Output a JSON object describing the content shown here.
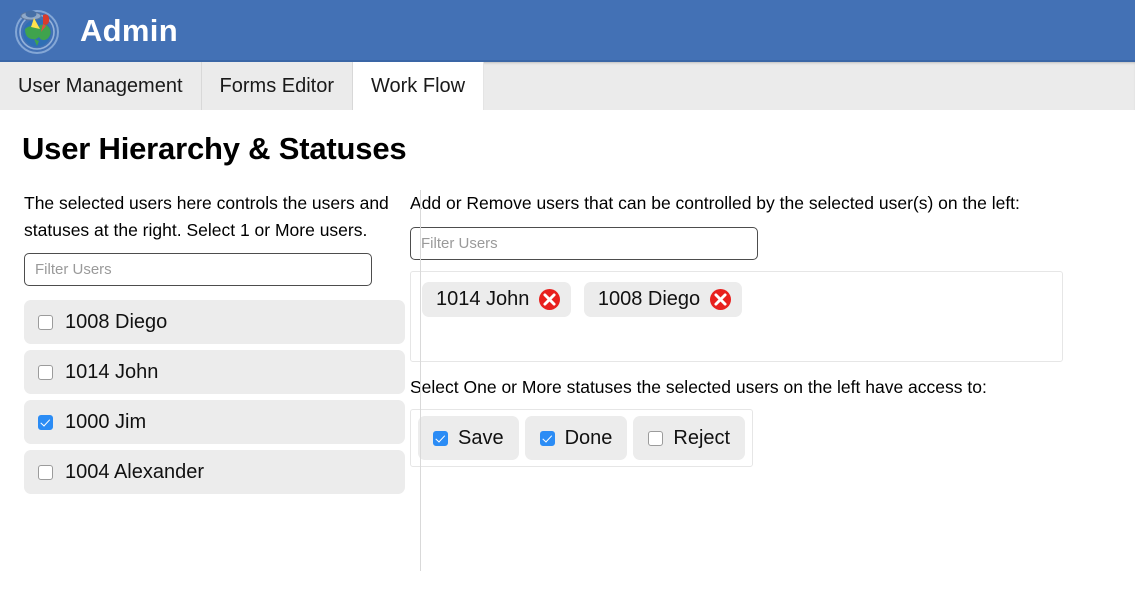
{
  "header": {
    "title": "Admin",
    "logo_icon": "globe-satellite-pin-icon",
    "background_color": "#4371b5"
  },
  "tabs": [
    {
      "label": "User Management",
      "active": false
    },
    {
      "label": "Forms Editor",
      "active": false
    },
    {
      "label": "Work Flow",
      "active": true
    }
  ],
  "page": {
    "title": "User Hierarchy & Statuses"
  },
  "left_panel": {
    "helper_text": "The selected users here controls the users and statuses at the right. Select 1 or More users.",
    "filter": {
      "placeholder": "Filter Users",
      "value": ""
    },
    "users": [
      {
        "label": "1008 Diego",
        "checked": false
      },
      {
        "label": "1014 John",
        "checked": false
      },
      {
        "label": "1000 Jim",
        "checked": true
      },
      {
        "label": "1004 Alexander",
        "checked": false
      }
    ]
  },
  "right_panel": {
    "controlled_users_text": "Add or Remove users that can be controlled by the selected user(s) on the left:",
    "filter": {
      "placeholder": "Filter Users",
      "value": ""
    },
    "chips": [
      {
        "label": "1014 John",
        "remove_icon": "remove-circle-icon"
      },
      {
        "label": "1008 Diego",
        "remove_icon": "remove-circle-icon"
      }
    ],
    "statuses_text": "Select One or More statuses the selected users on the left have access to:",
    "statuses": [
      {
        "label": "Save",
        "checked": true
      },
      {
        "label": "Done",
        "checked": true
      },
      {
        "label": "Reject",
        "checked": false
      }
    ]
  },
  "colors": {
    "header_blue": "#4371b5",
    "checkbox_blue": "#2b8cf5",
    "remove_red": "#e8201e",
    "pill_grey": "#ececec",
    "tab_inactive": "#ebebeb"
  }
}
